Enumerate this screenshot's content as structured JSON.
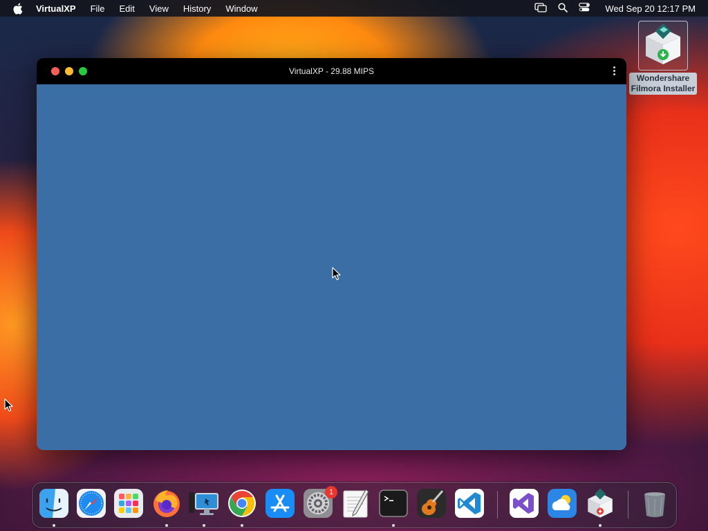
{
  "menubar": {
    "app_name": "VirtualXP",
    "items": [
      "File",
      "Edit",
      "View",
      "History",
      "Window"
    ],
    "clock": "Wed Sep 20  12:17 PM"
  },
  "desktop": {
    "icon_label_line1": "Wondershare",
    "icon_label_line2": "Filmora Installer"
  },
  "window": {
    "title": "VirtualXP - 29.88 MIPS",
    "screen_color": "#3c6ea6"
  },
  "dock": {
    "items": [
      {
        "name": "Finder",
        "icon": "finder-icon",
        "running": true
      },
      {
        "name": "Safari",
        "icon": "safari-icon",
        "running": false
      },
      {
        "name": "Launchpad",
        "icon": "launchpad-icon",
        "running": false
      },
      {
        "name": "Firefox",
        "icon": "firefox-icon",
        "running": true
      },
      {
        "name": "Remote Desktop",
        "icon": "remote-desktop-icon",
        "running": true
      },
      {
        "name": "Chrome",
        "icon": "chrome-icon",
        "running": true
      },
      {
        "name": "App Store",
        "icon": "app-store-icon",
        "running": false
      },
      {
        "name": "System Settings",
        "icon": "system-settings-icon",
        "running": false,
        "badge": "1"
      },
      {
        "name": "TextEdit",
        "icon": "textedit-icon",
        "running": false
      },
      {
        "name": "Terminal",
        "icon": "terminal-icon",
        "running": true
      },
      {
        "name": "GarageBand",
        "icon": "garageband-icon",
        "running": false
      },
      {
        "name": "Visual Studio Code",
        "icon": "vscode-icon",
        "running": false
      },
      {
        "name": "Visual Studio",
        "icon": "visual-studio-icon",
        "running": false
      },
      {
        "name": "Weather",
        "icon": "weather-icon",
        "running": false
      },
      {
        "name": "Filmora Installer",
        "icon": "filmora-installer-icon",
        "running": true
      },
      {
        "name": "Trash",
        "icon": "trash-icon",
        "running": false
      }
    ],
    "badge_count": "1"
  }
}
